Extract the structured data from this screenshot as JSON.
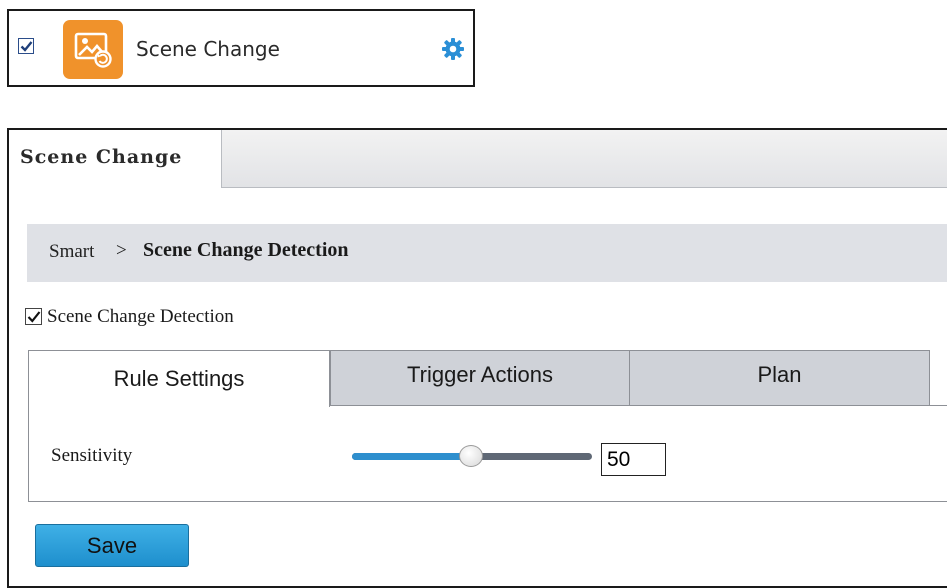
{
  "card": {
    "title": "Scene Change",
    "checked": true,
    "app_icon": "scene-change-image-icon",
    "settings_icon": "gear-icon",
    "tile_color": "#f0922b",
    "gear_color": "#2b8fd6"
  },
  "page": {
    "tab_label": "Scene Change",
    "breadcrumb": {
      "root": "Smart",
      "separator": ">",
      "current": "Scene Change Detection"
    },
    "enable": {
      "label": "Scene Change Detection",
      "checked": true
    },
    "tabs": [
      {
        "label": "Rule Settings",
        "active": true
      },
      {
        "label": "Trigger Actions",
        "active": false
      },
      {
        "label": "Plan",
        "active": false
      }
    ],
    "sensitivity": {
      "label": "Sensitivity",
      "value": "50",
      "min": 1,
      "max": 100
    },
    "save_label": "Save",
    "accent_color": "#2e8fce"
  }
}
